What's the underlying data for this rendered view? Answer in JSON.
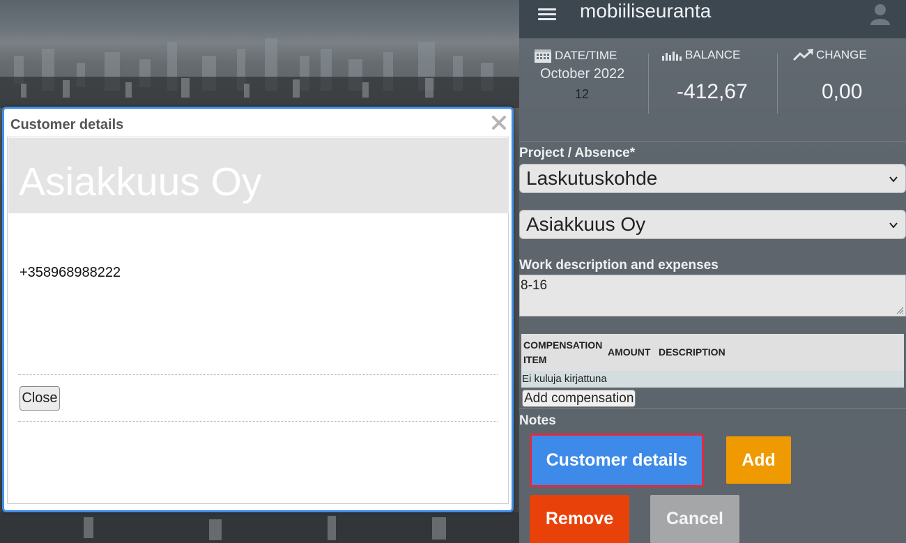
{
  "header": {
    "app_title": "mobiiliseuranta",
    "icons": {
      "menu": "hamburger-menu-icon",
      "user": "user-avatar-icon"
    }
  },
  "stats": {
    "datetime": {
      "label": "DATE/TIME",
      "month": "October 2022",
      "day": "12",
      "icon": "calendar-icon"
    },
    "balance": {
      "label": "BALANCE",
      "value": "-412,67",
      "icon": "bar-chart-icon"
    },
    "change": {
      "label": "CHANGE",
      "value": "0,00",
      "icon": "trending-up-icon"
    }
  },
  "form": {
    "project_label": "Project / Absence*",
    "project_value": "Laskutuskohde",
    "customer_value": "Asiakkuus Oy",
    "work_label": "Work description and expenses",
    "work_value": "8-16",
    "compensation": {
      "columns": [
        "COMPENSATION ITEM",
        "AMOUNT",
        "DESCRIPTION"
      ],
      "empty_text": "Ei kuluja kirjattuna",
      "add_label": "Add compensation"
    },
    "notes_label": "Notes"
  },
  "buttons": {
    "customer_details": "Customer details",
    "add": "Add",
    "remove": "Remove",
    "cancel": "Cancel"
  },
  "colors": {
    "accent_blue": "#3e8ae8",
    "add_orange": "#ee9a00",
    "remove_red": "#e8420a",
    "cancel_gray": "#a4a6a8",
    "highlight_border": "#e02b3d"
  },
  "modal": {
    "title": "Customer details",
    "customer_name": "Asiakkuus Oy",
    "phone": "+358968988222",
    "close_label": "Close"
  }
}
